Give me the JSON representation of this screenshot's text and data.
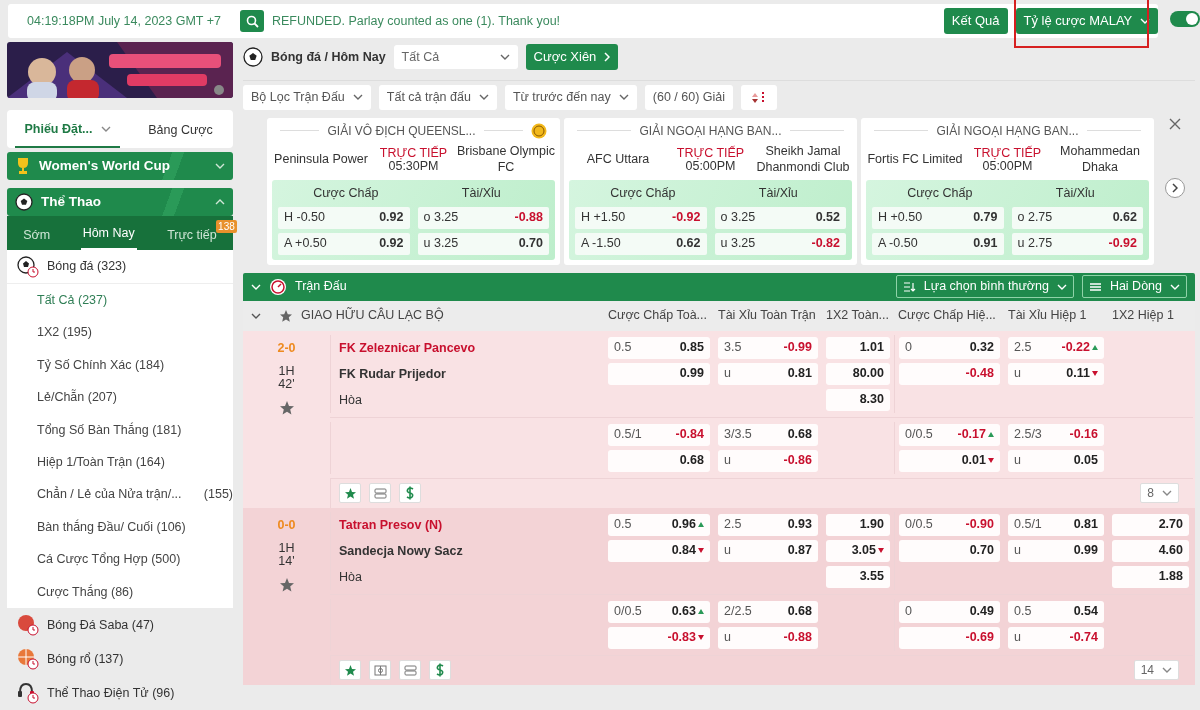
{
  "topbar": {
    "clock": "04:19:18PM July 14, 2023 GMT +7",
    "message": "REFUNDED. Parlay counted as one (1). Thank you!",
    "results_button": "Kết Quả",
    "odds_format": {
      "label": "Tỷ lệ cược MALAY",
      "highlighted": true
    },
    "toggle": {
      "on": true
    }
  },
  "sidebar": {
    "tabs": [
      {
        "label": "Phiếu Đặt...",
        "selected": true,
        "dropdown": true
      },
      {
        "label": "Bảng Cược",
        "selected": false,
        "dropdown": false
      }
    ],
    "sections": [
      {
        "title": "Women's World Cup",
        "expanded": false
      },
      {
        "title": "Thể Thao",
        "expanded": true
      }
    ],
    "sport_tabs": [
      {
        "label": "Sớm",
        "selected": false
      },
      {
        "label": "Hôm Nay",
        "selected": true
      },
      {
        "label": "Trực tiếp",
        "selected": false,
        "badge": "138"
      }
    ],
    "sports": [
      {
        "label": "Bóng đá (323)",
        "expanded": true,
        "children": [
          {
            "label": "Tất Cả (237)",
            "selected": true
          },
          {
            "label": "1X2 (195)",
            "selected": false
          },
          {
            "label": "Tỷ Số Chính Xác (184)",
            "selected": false
          },
          {
            "label": "Lẻ/Chẵn (207)",
            "selected": false
          },
          {
            "label": "Tổng Số Bàn Thắng (181)",
            "selected": false
          },
          {
            "label": "Hiệp 1/Toàn Trận (164)",
            "selected": false
          },
          {
            "label": "Chẳn / Lẻ của Nửa trận/...",
            "count": "(155)",
            "selected": false
          },
          {
            "label": "Bàn thắng Đầu/ Cuối (106)",
            "selected": false
          },
          {
            "label": "Cá Cược Tổng Hợp (500)",
            "selected": false
          },
          {
            "label": "Cược Thắng (86)",
            "selected": false
          }
        ]
      },
      {
        "label": "Bóng Đá Saba (47)",
        "expanded": false
      },
      {
        "label": "Bóng rổ (137)",
        "expanded": false
      },
      {
        "label": "Thể Thao Điện Tử (96)",
        "expanded": false
      }
    ]
  },
  "main": {
    "breadcrumb": "Bóng đá / Hôm Nay",
    "market_select": "Tất Cả",
    "parlay_button": "Cược Xiên",
    "filters": [
      {
        "label": "Bộ Lọc Trận Đấu",
        "kind": "dropdown"
      },
      {
        "label": "Tất cả trận đấu",
        "kind": "dropdown"
      },
      {
        "label": "Từ trước đến nay",
        "kind": "dropdown"
      },
      {
        "label": "(60 / 60) Giải",
        "kind": "plain"
      }
    ],
    "featured": [
      {
        "league": "GIẢI VÔ ĐỊCH QUEENSL...",
        "coin": true,
        "home": "Peninsula Power",
        "status": "TRỰC TIẾP",
        "time": "05:30PM",
        "away": "Brisbane Olympic FC",
        "handicap_title": "Cược Chấp",
        "ou_title": "Tài/Xỉu",
        "handicap": [
          {
            "side": "H",
            "line": "-0.50",
            "price": "0.92"
          },
          {
            "side": "A",
            "line": "+0.50",
            "price": "0.92"
          }
        ],
        "ou": [
          {
            "side": "o",
            "line": "3.25",
            "price": "-0.88"
          },
          {
            "side": "u",
            "line": "3.25",
            "price": "0.70"
          }
        ]
      },
      {
        "league": "GIẢI NGOẠI HẠNG BAN...",
        "coin": false,
        "home": "AFC Uttara",
        "status": "TRỰC TIẾP",
        "time": "05:00PM",
        "away": "Sheikh Jamal Dhanmondi Club",
        "handicap_title": "Cược Chấp",
        "ou_title": "Tài/Xỉu",
        "handicap": [
          {
            "side": "H",
            "line": "+1.50",
            "price": "-0.92"
          },
          {
            "side": "A",
            "line": "-1.50",
            "price": "0.62"
          }
        ],
        "ou": [
          {
            "side": "o",
            "line": "3.25",
            "price": "0.52"
          },
          {
            "side": "u",
            "line": "3.25",
            "price": "-0.82"
          }
        ]
      },
      {
        "league": "GIẢI NGOẠI HẠNG BAN...",
        "coin": false,
        "home": "Fortis FC Limited",
        "status": "TRỰC TIẾP",
        "time": "05:00PM",
        "away": "Mohammedan Dhaka",
        "handicap_title": "Cược Chấp",
        "ou_title": "Tài/Xỉu",
        "handicap": [
          {
            "side": "H",
            "line": "+0.50",
            "price": "0.79"
          },
          {
            "side": "A",
            "line": "-0.50",
            "price": "0.91"
          }
        ],
        "ou": [
          {
            "side": "o",
            "line": "2.75",
            "price": "0.62"
          },
          {
            "side": "u",
            "line": "2.75",
            "price": "-0.92"
          }
        ]
      }
    ],
    "panel_title": "Trận Đấu",
    "view_select": "Lựa chọn bình thường",
    "rows_select": "Hai Dòng",
    "league": "GIAO HỮU CÂU LẠC BỘ",
    "columns": [
      "Cược Chấp Toà...",
      "Tài Xỉu Toàn Trận",
      "1X2 Toàn...",
      "Cược Chấp Hiệ...",
      "Tài Xỉu Hiệp 1",
      "1X2 Hiệp 1"
    ],
    "matches": [
      {
        "score": "2-0",
        "period": "1H",
        "minute": "42'",
        "favorite": false,
        "home": "FK Zeleznicar Pancevo",
        "away": "FK Rudar Prijedor",
        "draw": "Hòa",
        "stats_icon": false,
        "more": "8",
        "groups": [
          [
            [
              {
                "kind": "odds",
                "line": "0.5",
                "price": "0.85"
              },
              {
                "kind": "odds",
                "line": "3.5",
                "price": "-0.99"
              },
              {
                "kind": "odds",
                "price": "1.01"
              },
              {
                "kind": "odds",
                "line": "0",
                "price": "0.32"
              },
              {
                "kind": "odds",
                "line": "2.5",
                "price": "-0.22",
                "rising": true
              },
              {
                "kind": "blank"
              }
            ],
            [
              {
                "kind": "odds",
                "price": "0.99"
              },
              {
                "kind": "odds",
                "line": "u",
                "price": "0.81"
              },
              {
                "kind": "odds",
                "price": "80.00"
              },
              {
                "kind": "odds",
                "price": "-0.48"
              },
              {
                "kind": "odds",
                "line": "u",
                "price": "0.11",
                "rising": false
              },
              {
                "kind": "blank"
              }
            ],
            [
              {
                "kind": "blank"
              },
              {
                "kind": "blank"
              },
              {
                "kind": "odds",
                "price": "8.30"
              },
              {
                "kind": "blank"
              },
              {
                "kind": "blank"
              },
              {
                "kind": "blank"
              }
            ]
          ],
          [
            [
              {
                "kind": "odds",
                "line": "0.5/1",
                "price": "-0.84"
              },
              {
                "kind": "odds",
                "line": "3/3.5",
                "price": "0.68"
              },
              {
                "kind": "blank"
              },
              {
                "kind": "odds",
                "line": "0/0.5",
                "price": "-0.17",
                "rising": true
              },
              {
                "kind": "odds",
                "line": "2.5/3",
                "price": "-0.16"
              },
              {
                "kind": "blank"
              }
            ],
            [
              {
                "kind": "odds",
                "price": "0.68"
              },
              {
                "kind": "odds",
                "line": "u",
                "price": "-0.86"
              },
              {
                "kind": "blank"
              },
              {
                "kind": "odds",
                "price": "0.01",
                "rising": false
              },
              {
                "kind": "odds",
                "line": "u",
                "price": "0.05"
              },
              {
                "kind": "blank"
              }
            ]
          ]
        ]
      },
      {
        "score": "0-0",
        "period": "1H",
        "minute": "14'",
        "favorite": false,
        "home": "Tatran Presov (N)",
        "away": "Sandecja Nowy Sacz",
        "draw": "Hòa",
        "stats_icon": true,
        "more": "14",
        "groups": [
          [
            [
              {
                "kind": "odds",
                "line": "0.5",
                "price": "0.96",
                "rising": true
              },
              {
                "kind": "odds",
                "line": "2.5",
                "price": "0.93"
              },
              {
                "kind": "odds",
                "price": "1.90"
              },
              {
                "kind": "odds",
                "line": "0/0.5",
                "price": "-0.90"
              },
              {
                "kind": "odds",
                "line": "0.5/1",
                "price": "0.81"
              },
              {
                "kind": "odds",
                "price": "2.70"
              }
            ],
            [
              {
                "kind": "odds",
                "price": "0.84",
                "rising": false
              },
              {
                "kind": "odds",
                "line": "u",
                "price": "0.87"
              },
              {
                "kind": "odds",
                "price": "3.05",
                "rising": false
              },
              {
                "kind": "odds",
                "price": "0.70"
              },
              {
                "kind": "odds",
                "line": "u",
                "price": "0.99"
              },
              {
                "kind": "odds",
                "price": "4.60"
              }
            ],
            [
              {
                "kind": "blank"
              },
              {
                "kind": "blank"
              },
              {
                "kind": "odds",
                "price": "3.55"
              },
              {
                "kind": "blank"
              },
              {
                "kind": "blank"
              },
              {
                "kind": "odds",
                "price": "1.88"
              }
            ]
          ],
          [
            [
              {
                "kind": "odds",
                "line": "0/0.5",
                "price": "0.63",
                "rising": true
              },
              {
                "kind": "odds",
                "line": "2/2.5",
                "price": "0.68"
              },
              {
                "kind": "blank"
              },
              {
                "kind": "odds",
                "line": "0",
                "price": "0.49"
              },
              {
                "kind": "odds",
                "line": "0.5",
                "price": "0.54"
              },
              {
                "kind": "blank"
              }
            ],
            [
              {
                "kind": "odds",
                "price": "-0.83",
                "rising": false
              },
              {
                "kind": "odds",
                "line": "u",
                "price": "-0.88"
              },
              {
                "kind": "blank"
              },
              {
                "kind": "odds",
                "price": "-0.69"
              },
              {
                "kind": "odds",
                "line": "u",
                "price": "-0.74"
              },
              {
                "kind": "blank"
              }
            ]
          ]
        ]
      }
    ]
  }
}
